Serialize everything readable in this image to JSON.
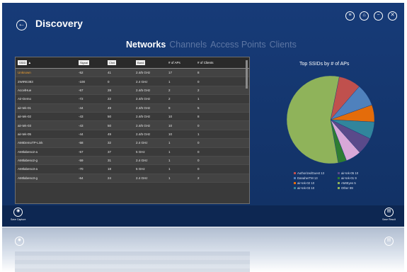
{
  "header": {
    "title": "Discovery",
    "icons": [
      "back-icon",
      "menu-icon",
      "home-icon",
      "minimize-icon",
      "close-icon"
    ]
  },
  "tabs": [
    {
      "label": "Networks",
      "active": true
    },
    {
      "label": "Channels",
      "active": false
    },
    {
      "label": "Access Points",
      "active": false
    },
    {
      "label": "Clients",
      "active": false
    }
  ],
  "table": {
    "columns": [
      "SSID",
      "Signal",
      "Chnl",
      "Band",
      "# of APs",
      "# of Clients"
    ],
    "rows": [
      {
        "ssid": "Unknown",
        "signal": "-52",
        "chnl": "41",
        "band": "2.4/5 GHz",
        "aps": "17",
        "clients": "8",
        "selected": true
      },
      {
        "ssid": "2WIRE383",
        "signal": "-100",
        "chnl": "0",
        "band": "2.4 GHz",
        "aps": "1",
        "clients": "0"
      },
      {
        "ssid": "AccelHue",
        "signal": "-67",
        "chnl": "28",
        "band": "2.4/5 GHz",
        "aps": "2",
        "clients": "2"
      },
      {
        "ssid": "Air-Demo",
        "signal": "-72",
        "chnl": "22",
        "band": "2.4/5 GHz",
        "aps": "2",
        "clients": "1"
      },
      {
        "ssid": "air-tek-01",
        "signal": "-44",
        "chnl": "49",
        "band": "2.4/5 GHz",
        "aps": "9",
        "clients": "5"
      },
      {
        "ssid": "air-tek-02",
        "signal": "-43",
        "chnl": "50",
        "band": "2.4/5 GHz",
        "aps": "10",
        "clients": "8"
      },
      {
        "ssid": "air-tek-03",
        "signal": "-43",
        "chnl": "50",
        "band": "2.4/5 GHz",
        "aps": "10",
        "clients": "0"
      },
      {
        "ssid": "air-tek-05",
        "signal": "-44",
        "chnl": "49",
        "band": "2.4/5 GHz",
        "aps": "10",
        "clients": "1"
      },
      {
        "ssid": "AMIDemoTP-Link",
        "signal": "-58",
        "chnl": "32",
        "band": "2.4 GHz",
        "aps": "1",
        "clients": "0"
      },
      {
        "ssid": "AMIlabeno2-a",
        "signal": "-57",
        "chnl": "37",
        "band": "5 GHz",
        "aps": "1",
        "clients": "0"
      },
      {
        "ssid": "AMIlabeno2-g",
        "signal": "-59",
        "chnl": "31",
        "band": "2.4 GHz",
        "aps": "1",
        "clients": "0"
      },
      {
        "ssid": "AMIlabeno3-a",
        "signal": "-70",
        "chnl": "18",
        "band": "5 GHz",
        "aps": "1",
        "clients": "0"
      },
      {
        "ssid": "AMIlabeno3-g",
        "signal": "-64",
        "chnl": "24",
        "band": "2.4 GHz",
        "aps": "1",
        "clients": "2"
      }
    ]
  },
  "chart": {
    "title": "Top SSIDs by # of APs",
    "legend": [
      "AuthorizedGuest 13",
      "air-tek-05 10",
      "DanaherTM 13",
      "air-tek-01 9",
      "air-tek-02 10",
      "AMIEyes 5",
      "air-tek-03 10",
      "Other 89"
    ],
    "colors": {
      "bg": "#173b78"
    }
  },
  "chart_data": {
    "type": "pie",
    "title": "Top SSIDs by # of APs",
    "categories": [
      "AuthorizedGuest",
      "DanaherTM",
      "air-tek-02",
      "air-tek-03",
      "air-tek-05",
      "air-tek-01",
      "AMIEyes",
      "Other"
    ],
    "values": [
      13,
      13,
      10,
      10,
      10,
      9,
      5,
      89
    ],
    "colors": [
      "#c0504d",
      "#4f81bd",
      "#e46c0a",
      "#31859c",
      "#5a4a8a",
      "#d8a8d8",
      "#2e7d32",
      "#8fb35a"
    ],
    "legend_position": "bottom"
  },
  "bottombar": {
    "left_label": "Save Capture",
    "right_label": "Save Result"
  }
}
